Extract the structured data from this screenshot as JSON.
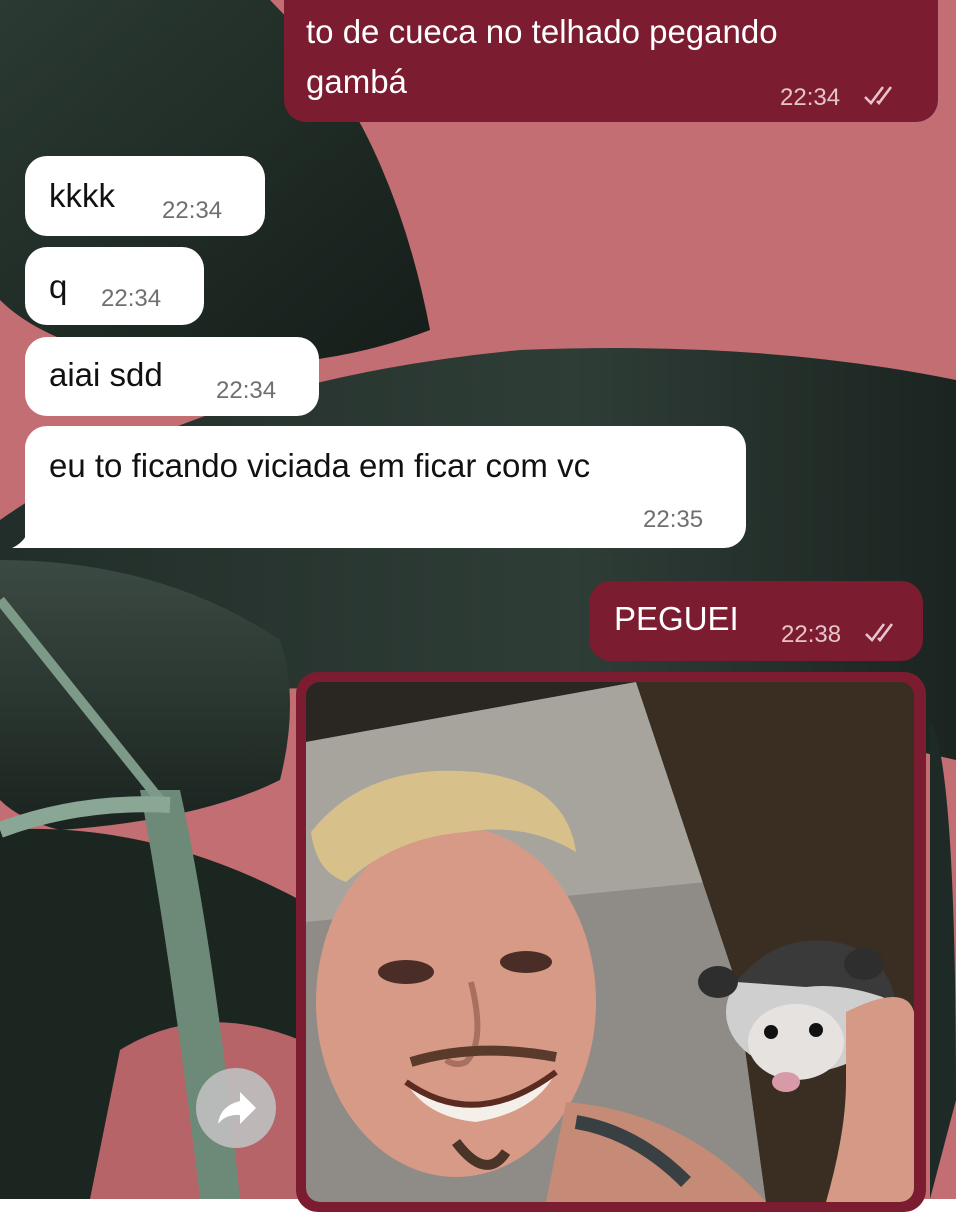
{
  "chat": {
    "messages": [
      {
        "direction": "out",
        "text_line1": "to de cueca no telhado pegando",
        "text_line2": "gambá",
        "time": "22:34",
        "status": "read"
      },
      {
        "direction": "in",
        "text": "kkkk",
        "time": "22:34"
      },
      {
        "direction": "in",
        "text": "q",
        "time": "22:34"
      },
      {
        "direction": "in",
        "text": "aiai sdd",
        "time": "22:34"
      },
      {
        "direction": "in",
        "text": "eu to ficando viciada em ficar com vc",
        "time": "22:35"
      },
      {
        "direction": "out",
        "text": "PEGUEI",
        "time": "22:38",
        "status": "read"
      },
      {
        "direction": "out",
        "type": "photo"
      }
    ]
  },
  "colors": {
    "incoming_bubble": "#ffffff",
    "outgoing_bubble": "#7b1c30",
    "wallpaper_pink": "#c26e73",
    "wallpaper_leaf": "#1e2a25"
  },
  "icons": {
    "read_receipt": "double-check-icon",
    "share": "share-forward-icon"
  }
}
